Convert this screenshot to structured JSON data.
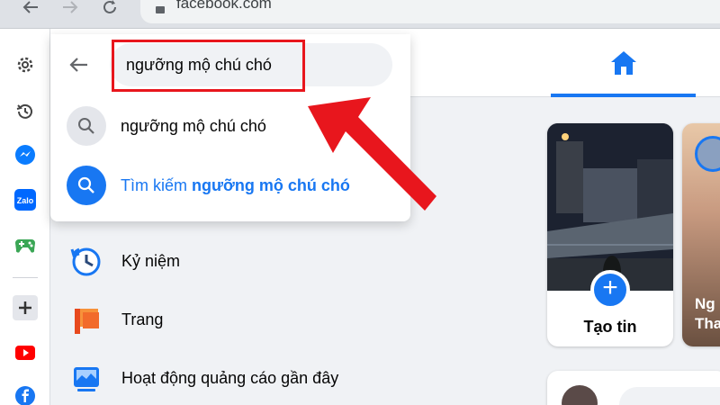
{
  "browser": {
    "url": "facebook.com",
    "back_icon": "arrow-left-icon",
    "forward_icon": "arrow-right-icon",
    "reload_icon": "reload-icon"
  },
  "extensions": [
    {
      "name": "settings",
      "icon": "gear-icon"
    },
    {
      "name": "history",
      "icon": "history-icon"
    },
    {
      "name": "messenger",
      "icon": "messenger-icon"
    },
    {
      "name": "zalo",
      "icon": "zalo-icon",
      "label": "Zalo"
    },
    {
      "name": "games",
      "icon": "gamepad-icon"
    },
    {
      "name": "add",
      "icon": "plus-icon"
    },
    {
      "name": "youtube",
      "icon": "youtube-icon"
    },
    {
      "name": "facebook",
      "icon": "facebook-icon"
    }
  ],
  "search": {
    "value": "ngưỡng mộ chú chó",
    "suggestion_text": "ngưỡng mộ chú chó",
    "search_prefix": "Tìm kiếm",
    "search_query": "ngưỡng mộ chú chó"
  },
  "menu": {
    "items": [
      {
        "label": "Kỷ niệm",
        "icon": "memories-clock-icon"
      },
      {
        "label": "Trang",
        "icon": "pages-flag-icon"
      },
      {
        "label": "Hoạt động quảng cáo gần đây",
        "icon": "ad-activity-icon"
      }
    ]
  },
  "stories": {
    "create_label": "Tạo tin",
    "second_name_line1": "Ng",
    "second_name_line2": "Tha"
  },
  "colors": {
    "facebook_blue": "#1877f2",
    "annotation_red": "#e8161d"
  }
}
